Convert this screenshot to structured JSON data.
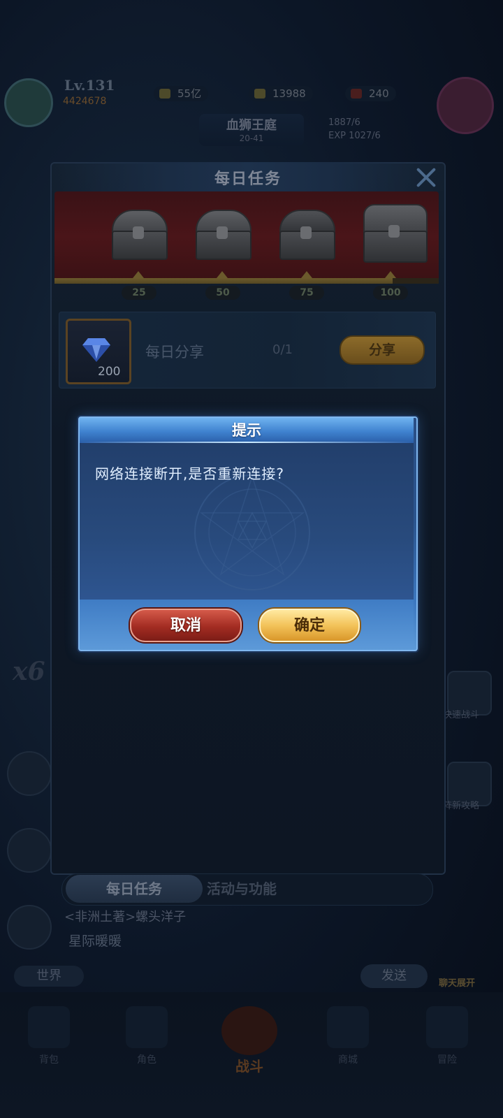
{
  "background": {
    "player": {
      "level": "Lv.131",
      "power": "4424678"
    },
    "resources": [
      {
        "icon": "gold-icon",
        "value": "55亿"
      },
      {
        "icon": "diamond-icon",
        "value": "13988"
      },
      {
        "icon": "stamina-icon",
        "value": "240"
      }
    ],
    "stage": {
      "name": "血狮王庭",
      "number": "20-41"
    },
    "exp": {
      "line1": "1887/6",
      "line2": "EXP 1027/6"
    },
    "side_left": {
      "multiplier": "x6"
    },
    "side_right": [
      {
        "label": "快速战斗",
        "icon": "hourglass-icon"
      },
      {
        "label": "阵新攻略",
        "icon": "book-icon"
      }
    ],
    "chat": {
      "sender": "<非洲土著>螺头洋子",
      "message": "星际暖暖",
      "world_button": "世界",
      "send_button": "发送",
      "expand_label": "聊天展开"
    },
    "nav": [
      {
        "label": "背包",
        "icon": "bag-icon"
      },
      {
        "label": "角色",
        "icon": "hero-icon"
      },
      {
        "label": "战斗",
        "icon": "crossed-swords-icon"
      },
      {
        "label": "商城",
        "icon": "shop-icon"
      },
      {
        "label": "冒险",
        "icon": "map-icon"
      }
    ]
  },
  "daily_panel": {
    "title": "每日任务",
    "close_icon": "close-icon",
    "progress_value": 0.88,
    "milestones": [
      {
        "value": "25",
        "icon": "chest-icon"
      },
      {
        "value": "50",
        "icon": "chest-icon"
      },
      {
        "value": "75",
        "icon": "chest-icon"
      },
      {
        "value": "100",
        "icon": "chest-icon"
      }
    ],
    "task": {
      "reward_icon": "diamond-icon",
      "reward_count": "200",
      "name": "每日分享",
      "progress": "0/1",
      "action": "分享"
    },
    "tabs": {
      "active": "每日任务",
      "inactive": "活动与功能"
    }
  },
  "dialog": {
    "title": "提示",
    "message": "网络连接断开,是否重新连接?",
    "cancel": "取消",
    "confirm": "确定"
  },
  "colors": {
    "accent_blue": "#3d78c0",
    "cancel_red": "#a32c22",
    "confirm_gold": "#f3c35a"
  }
}
